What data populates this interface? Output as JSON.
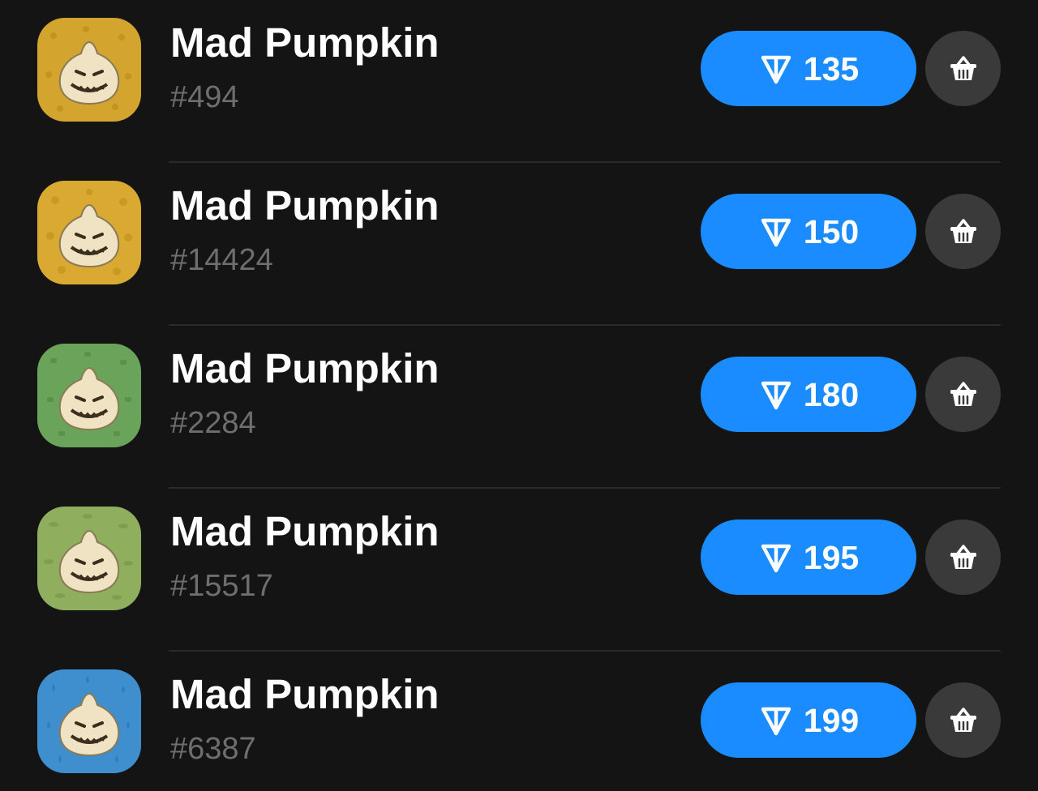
{
  "items": [
    {
      "title": "Mad Pumpkin",
      "number": "#494",
      "price": "135",
      "bg": "#d4a52e",
      "bg_pattern": "#c4951e"
    },
    {
      "title": "Mad Pumpkin",
      "number": "#14424",
      "price": "150",
      "bg": "#d9a931",
      "bg_pattern": "#c99a22"
    },
    {
      "title": "Mad Pumpkin",
      "number": "#2284",
      "price": "180",
      "bg": "#6aa35a",
      "bg_pattern": "#5a9249"
    },
    {
      "title": "Mad Pumpkin",
      "number": "#15517",
      "price": "195",
      "bg": "#8fae5e",
      "bg_pattern": "#7f9f4e"
    },
    {
      "title": "Mad Pumpkin",
      "number": "#6387",
      "price": "199",
      "bg": "#3f8fcf",
      "bg_pattern": "#2f7fbf"
    }
  ],
  "theme": {
    "accent": "#1a8cff",
    "background": "#141414",
    "cart_bg": "#3a3a3a",
    "subtext": "#6e6e6e"
  },
  "icons": {
    "currency": "ton-icon",
    "cart": "basket-icon",
    "thumbnail": "mad-pumpkin-gift-icon"
  }
}
